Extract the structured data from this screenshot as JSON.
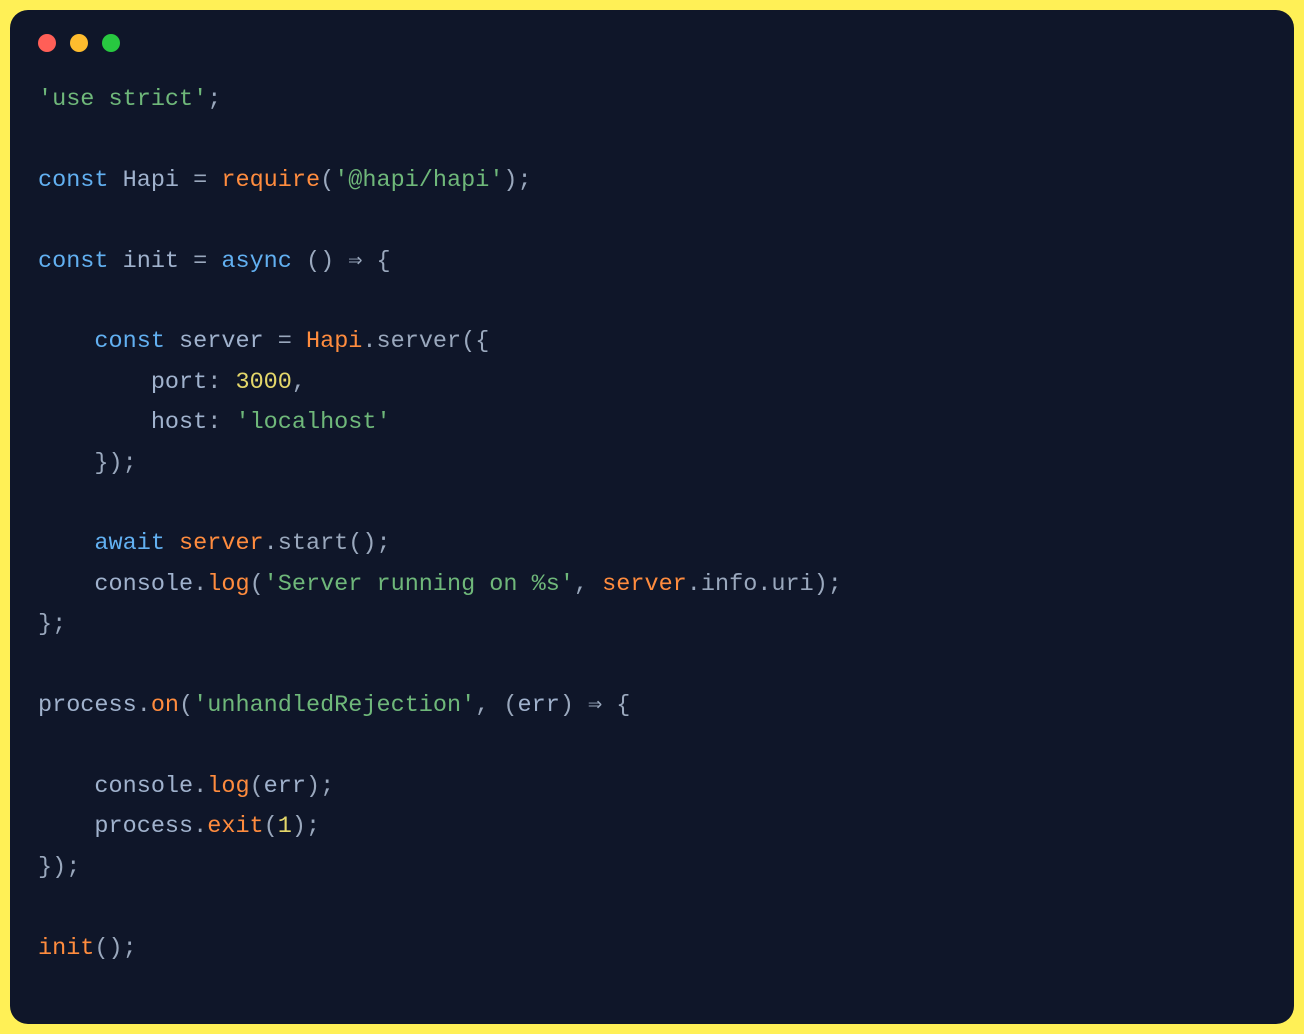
{
  "colors": {
    "outer": "#fff056",
    "inner": "#0f1629",
    "traffic_red": "#ff5f57",
    "traffic_yellow": "#febc2e",
    "traffic_green": "#28c840"
  },
  "code": {
    "l01_use_strict": "'use strict'",
    "l01_semi": ";",
    "l03_const": "const ",
    "l03_hapi": "Hapi",
    "l03_eq": " = ",
    "l03_require": "require",
    "l03_par_open": "(",
    "l03_arg": "'@hapi/hapi'",
    "l03_par_close_semi": ");",
    "l05_const": "const ",
    "l05_init": "init",
    "l05_eq": " = ",
    "l05_async": "async",
    "l05_arrow": " () ⇒ {",
    "l07_indent": "    ",
    "l07_const": "const ",
    "l07_server": "server",
    "l07_eq": " = ",
    "l07_hapi": "Hapi",
    "l07_dot_server_open": ".server({",
    "l08_indent": "        ",
    "l08_port_key": "port",
    "l08_colon_sp": ": ",
    "l08_port_val": "3000",
    "l08_comma": ",",
    "l09_indent": "        ",
    "l09_host_key": "host",
    "l09_colon_sp": ": ",
    "l09_host_val": "'localhost'",
    "l10_close": "    });",
    "l12_indent": "    ",
    "l12_await": "await ",
    "l12_server": "server",
    "l12_start": ".start();",
    "l13_indent": "    ",
    "l13_console": "console",
    "l13_dot": ".",
    "l13_log": "log",
    "l13_open": "(",
    "l13_str": "'Server running on %s'",
    "l13_comma_sp": ", ",
    "l13_server": "server",
    "l13_info_uri": ".info.uri);",
    "l14_close": "};",
    "l16_process": "process",
    "l16_dot": ".",
    "l16_on": "on",
    "l16_open": "(",
    "l16_str": "'unhandledRejection'",
    "l16_comma_sp": ", (",
    "l16_err": "err",
    "l16_arrow": ") ⇒ {",
    "l18_indent": "    ",
    "l18_console": "console",
    "l18_dot": ".",
    "l18_log": "log",
    "l18_open": "(",
    "l18_err": "err",
    "l18_close": ");",
    "l19_indent": "    ",
    "l19_process": "process",
    "l19_dot": ".",
    "l19_exit": "exit",
    "l19_open": "(",
    "l19_one": "1",
    "l19_close": ");",
    "l20_close": "});",
    "l22_init": "init",
    "l22_call": "();"
  }
}
